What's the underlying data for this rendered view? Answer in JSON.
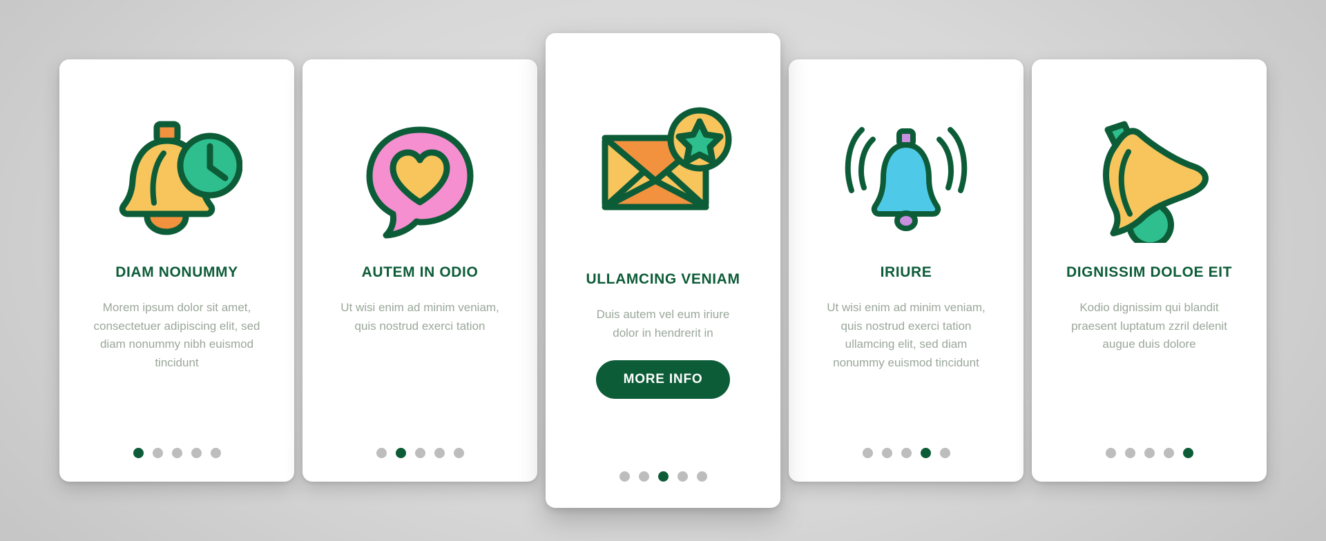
{
  "theme": {
    "accent_green": "#0d5c38",
    "body_text": "#9aa79a",
    "dot_inactive": "#bdbdbd",
    "card_bg": "#ffffff",
    "page_bg": "#d2d2d2",
    "icon_yellow": "#f7c55c",
    "icon_orange": "#f2923f",
    "icon_teal": "#2fbf8f",
    "icon_pink": "#f58fd0",
    "icon_blue": "#4fc9e8",
    "icon_violet": "#c98fe0"
  },
  "cards": [
    {
      "icon": "bell-clock-icon",
      "title": "DIAM NONUMMY",
      "body": "Morem ipsum dolor sit amet, consectetuer adipiscing elit, sed diam nonummy nibh euismod tincidunt",
      "dots": {
        "count": 5,
        "active": 0
      },
      "featured": false
    },
    {
      "icon": "heart-chat-bubble-icon",
      "title": "AUTEM IN ODIO",
      "body": "Ut wisi enim ad minim veniam, quis nostrud exerci tation",
      "dots": {
        "count": 5,
        "active": 1
      },
      "featured": false
    },
    {
      "icon": "envelope-star-icon",
      "title": "ULLAMCING VENIAM",
      "body": "Duis autem vel eum iriure dolor in hendrerit in",
      "button_label": "MORE INFO",
      "dots": {
        "count": 5,
        "active": 2
      },
      "featured": true
    },
    {
      "icon": "ringing-bell-icon",
      "title": "IRIURE",
      "body": "Ut wisi enim ad minim veniam, quis nostrud exerci tation ullamcing elit, sed diam nonummy euismod tincidunt",
      "dots": {
        "count": 5,
        "active": 3
      },
      "featured": false
    },
    {
      "icon": "tilted-bell-icon",
      "title": "DIGNISSIM DOLOE EIT",
      "body": "Kodio dignissim qui blandit praesent luptatum zzril delenit augue duis dolore",
      "dots": {
        "count": 5,
        "active": 4
      },
      "featured": false
    }
  ]
}
